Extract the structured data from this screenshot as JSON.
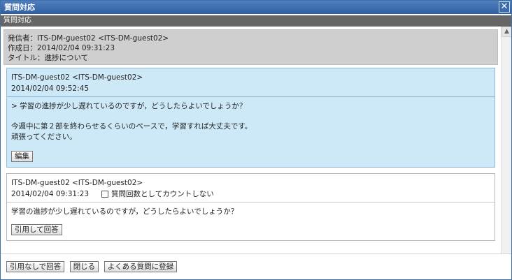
{
  "window": {
    "title": "質問対応",
    "subtitle": "質問対応"
  },
  "meta": {
    "sender": "発信者：ITS-DM-guest02 <ITS-DM-guest02>",
    "created": "作成日：2014/02/04 09:31:23",
    "title": "タイトル：進捗について"
  },
  "reply": {
    "author": "ITS-DM-guest02 <ITS-DM-guest02>",
    "date": "2014/02/04 09:52:45",
    "quote": "> 学習の進捗が少し遅れているのですが，どうしたらよいでしょうか？",
    "line1": "今週中に第２部を終わらせるくらいのペースで，学習すれば大丈夫です。",
    "line2": "頑張ってください。",
    "edit_label": "編集"
  },
  "question": {
    "author": "ITS-DM-guest02 <ITS-DM-guest02>",
    "date": "2014/02/04 09:31:23",
    "checkbox_label": "質問回数としてカウントしない",
    "body": "学習の進捗が少し遅れているのですが，どうしたらよいでしょうか？",
    "quote_reply_label": "引用して回答"
  },
  "footer": {
    "reply_no_quote": "引用なしで回答",
    "close": "閉じる",
    "register_faq": "よくある質問に登録"
  }
}
